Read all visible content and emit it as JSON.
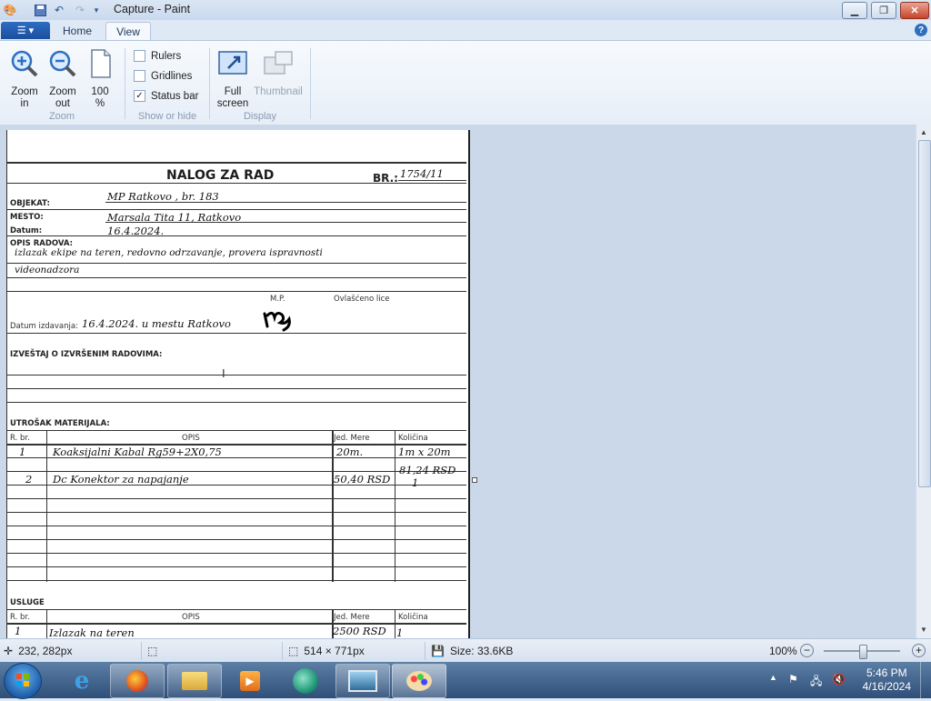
{
  "window": {
    "title": "Capture - Paint"
  },
  "tabs": {
    "home": "Home",
    "view": "View"
  },
  "ribbon": {
    "zoom_in": [
      "Zoom",
      "in"
    ],
    "zoom_out": [
      "Zoom",
      "out"
    ],
    "zoom_100": [
      "100",
      "%"
    ],
    "group_zoom": "Zoom",
    "rulers": "Rulers",
    "gridlines": "Gridlines",
    "statusbar": "Status bar",
    "group_show": "Show or hide",
    "fullscreen": [
      "Full",
      "screen"
    ],
    "thumbnail": "Thumbnail",
    "group_display": "Display"
  },
  "checkboxes": {
    "rulers": false,
    "gridlines": false,
    "statusbar": true
  },
  "document": {
    "title": "NALOG ZA RAD",
    "br_label": "BR.:",
    "br_value": "1754/11",
    "objekat_label": "OBJEKAT:",
    "objekat_value": "MP Ratkovo , br. 183",
    "mesto_label": "MESTO:",
    "mesto_value": "Marsala Tita 11, Ratkovo",
    "datum_label": "Datum:",
    "datum_value": "16.4.2024.",
    "opis_label": "OPIS RADOVA:",
    "opis_line1": "izlazak ekipe na teren, redovno odrzavanje, provera ispravnosti",
    "opis_line2": "videonadzora",
    "mp_label": "M.P.",
    "ovlasceno_label": "Ovlašćeno lice",
    "izdavanje_label": "Datum izdavanja:",
    "izdavanje_value": "16.4.2024. u mestu Ratkovo",
    "izvestaj_label": "IZVEŠTAJ O IZVRŠENIM RADOVIMA:",
    "utrosak_label": "UTROŠAK MATERIJALA:",
    "columns": {
      "rbr": "R. br.",
      "opis": "OPIS",
      "jed": "Jed. Mere",
      "kol": "Količina"
    },
    "materials": [
      {
        "rbr": "1",
        "opis": "Koaksijalni Kabal Rg59+2X0,75",
        "jed": "20m.",
        "kol": "1m x 20m",
        "kol2": "81,24 RSD"
      },
      {
        "rbr": "2",
        "opis": "Dc Konektor za napajanje",
        "jed": "50,40 RSD",
        "kol": "1"
      }
    ],
    "usluge_label": "USLUGE",
    "services": [
      {
        "rbr": "1",
        "opis": "Izlazak na teren",
        "jed": "2500 RSD",
        "kol": "1"
      }
    ]
  },
  "status": {
    "cursor": "232, 282px",
    "size": "514 × 771px",
    "filesize": "Size: 33.6KB",
    "zoom": "100%"
  },
  "clock": {
    "time": "5:46 PM",
    "date": "4/16/2024"
  }
}
